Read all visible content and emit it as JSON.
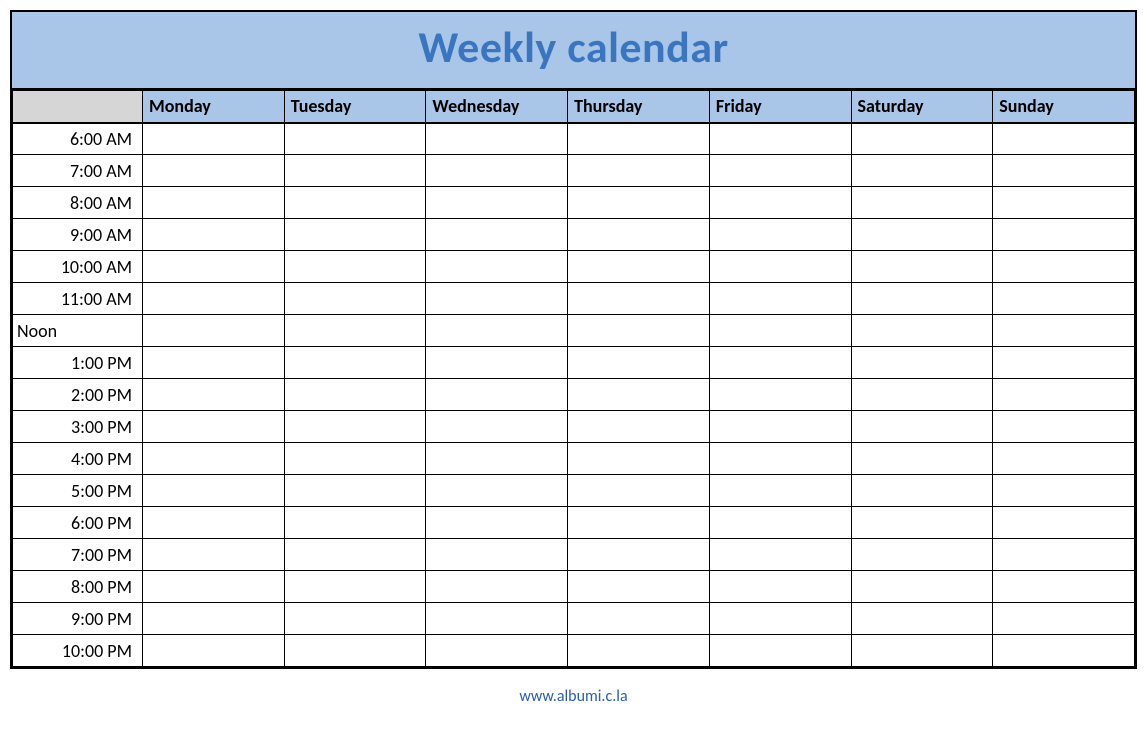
{
  "title": "Weekly calendar",
  "footer_url": "www.albumi.c.la",
  "days": [
    "Monday",
    "Tuesday",
    "Wednesday",
    "Thursday",
    "Friday",
    "Saturday",
    "Sunday"
  ],
  "times": [
    {
      "label": "6:00 AM",
      "align": "right"
    },
    {
      "label": "7:00 AM",
      "align": "right"
    },
    {
      "label": "8:00 AM",
      "align": "right"
    },
    {
      "label": "9:00 AM",
      "align": "right"
    },
    {
      "label": "10:00 AM",
      "align": "right"
    },
    {
      "label": "11:00 AM",
      "align": "right"
    },
    {
      "label": "Noon",
      "align": "left"
    },
    {
      "label": "1:00 PM",
      "align": "right"
    },
    {
      "label": "2:00 PM",
      "align": "right"
    },
    {
      "label": "3:00 PM",
      "align": "right"
    },
    {
      "label": "4:00 PM",
      "align": "right"
    },
    {
      "label": "5:00 PM",
      "align": "right"
    },
    {
      "label": "6:00 PM",
      "align": "right"
    },
    {
      "label": "7:00 PM",
      "align": "right"
    },
    {
      "label": "8:00 PM",
      "align": "right"
    },
    {
      "label": "9:00 PM",
      "align": "right"
    },
    {
      "label": "10:00 PM",
      "align": "right"
    }
  ],
  "colors": {
    "header_bg": "#a9c5e8",
    "title_text": "#3a76c0",
    "time_header_bg": "#d6d6d6"
  }
}
